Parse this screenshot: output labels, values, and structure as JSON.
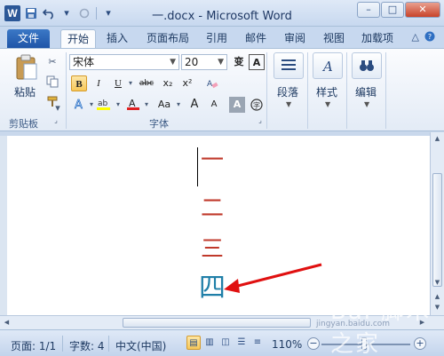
{
  "window": {
    "title": "一.docx - Microsoft Word",
    "app_icon": "W",
    "buttons": {
      "minimize": "–",
      "maximize": "□",
      "close": "✕"
    }
  },
  "tabs": [
    "文件",
    "开始",
    "插入",
    "页面布局",
    "引用",
    "邮件",
    "审阅",
    "视图",
    "加载项"
  ],
  "ribbon": {
    "clipboard": {
      "paste_label": "粘贴",
      "group_label": "剪贴板"
    },
    "font": {
      "font_name": "宋体",
      "font_size": "20",
      "group_label": "字体",
      "wen_icon": "变",
      "a_box": "A",
      "bold": "B",
      "italic": "I",
      "underline": "U",
      "strike": "abc",
      "subscript": "x₂",
      "superscript": "x²",
      "case": "Aa",
      "grow": "A",
      "shrink": "A",
      "color_a": "A"
    },
    "paragraph_label": "段落",
    "styles_label": "样式",
    "editing_label": "编辑"
  },
  "document": {
    "lines": [
      {
        "text": "一",
        "color": "#c0392b"
      },
      {
        "text": "二",
        "color": "#c0392b"
      },
      {
        "text": "三",
        "color": "#c0392b"
      },
      {
        "text": "四",
        "color": "#1f7fa8"
      }
    ]
  },
  "statusbar": {
    "page": "页面: 1/1",
    "words": "字数: 4",
    "language": "中文(中国)",
    "zoom": "110%",
    "zoom_minus": "−",
    "zoom_plus": "+"
  },
  "watermark": "jingyan.baidu.com"
}
